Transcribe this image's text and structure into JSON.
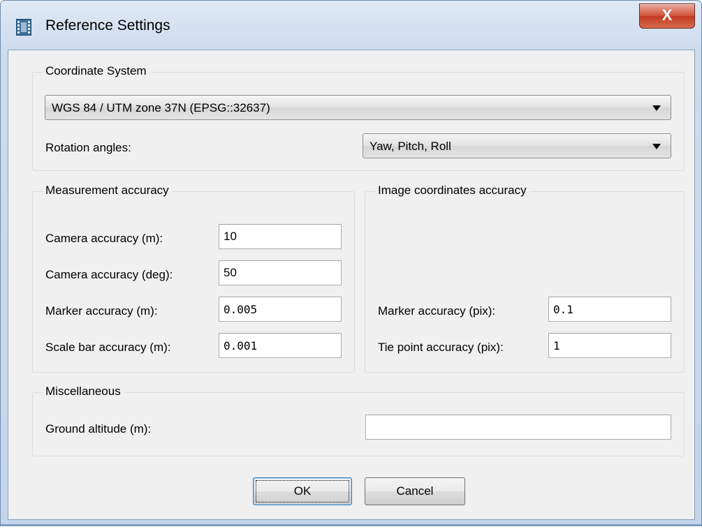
{
  "window": {
    "title": "Reference Settings",
    "close_label": "X"
  },
  "coordinate_system": {
    "group_label": "Coordinate System",
    "crs_value": "WGS 84 / UTM zone 37N (EPSG::32637)",
    "rotation_label": "Rotation angles:",
    "rotation_value": "Yaw, Pitch, Roll"
  },
  "measurement_accuracy": {
    "group_label": "Measurement accuracy",
    "camera_m_label": "Camera accuracy (m):",
    "camera_m_value": "10",
    "camera_deg_label": "Camera accuracy (deg):",
    "camera_deg_value": "50",
    "marker_m_label": "Marker accuracy (m):",
    "marker_m_value": "0.005",
    "scalebar_label": "Scale bar accuracy (m):",
    "scalebar_value": "0.001"
  },
  "image_accuracy": {
    "group_label": "Image coordinates accuracy",
    "marker_pix_label": "Marker accuracy (pix):",
    "marker_pix_value": "0.1",
    "tiepoint_label": "Tie point accuracy (pix):",
    "tiepoint_value": "1"
  },
  "miscellaneous": {
    "group_label": "Miscellaneous",
    "ground_altitude_label": "Ground altitude (m):",
    "ground_altitude_value": ""
  },
  "buttons": {
    "ok": "OK",
    "cancel": "Cancel"
  }
}
